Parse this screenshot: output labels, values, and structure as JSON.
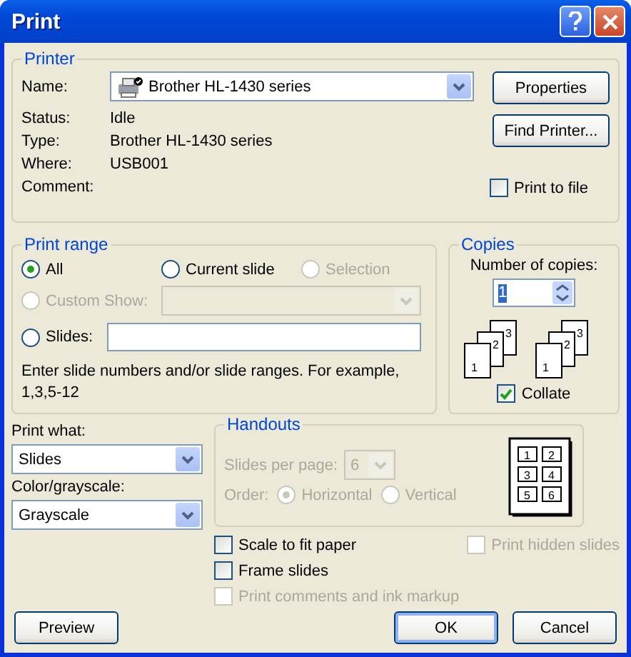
{
  "window": {
    "title": "Print"
  },
  "printer": {
    "label": "Printer",
    "name_label": "Name:",
    "name": "Brother HL-1430 series",
    "status_label": "Status:",
    "status": "Idle",
    "type_label": "Type:",
    "type": "Brother HL-1430 series",
    "where_label": "Where:",
    "where": "USB001",
    "comment_label": "Comment:",
    "buttons": [
      "Properties",
      "Find Printer..."
    ],
    "print_to_file": {
      "label": "Print to file",
      "checked": false
    }
  },
  "print_range": {
    "label": "Print range",
    "options": [
      {
        "label": "All",
        "selected": true,
        "disabled": false
      },
      {
        "label": "Current slide",
        "selected": false,
        "disabled": false
      },
      {
        "label": "Selection",
        "selected": false,
        "disabled": true
      },
      {
        "label": "Custom Show:",
        "selected": false,
        "disabled": true
      },
      {
        "label": "Slides:",
        "selected": false,
        "disabled": false
      }
    ],
    "hint": "Enter slide numbers and/or slide ranges. For example, 1,3,5-12"
  },
  "copies": {
    "label": "Copies",
    "count_label": "Number of copies:",
    "count": "1",
    "collate": {
      "label": "Collate",
      "checked": true
    },
    "page_numbers": [
      [
        "1",
        "2",
        "3"
      ],
      [
        "1",
        "2",
        "3"
      ]
    ]
  },
  "print_what": {
    "label": "Print what:",
    "value": "Slides"
  },
  "color": {
    "label": "Color/grayscale:",
    "value": "Grayscale"
  },
  "handouts": {
    "label": "Handouts",
    "disabled": true,
    "slides_per_page_label": "Slides per page:",
    "slides_per_page": "6",
    "order_label": "Order:",
    "order": [
      {
        "label": "Horizontal",
        "selected": true
      },
      {
        "label": "Vertical",
        "selected": false
      }
    ],
    "preview_numbers": [
      "1",
      "2",
      "3",
      "4",
      "5",
      "6"
    ]
  },
  "options": [
    {
      "label": "Scale to fit paper",
      "checked": false,
      "disabled": false
    },
    {
      "label": "Frame slides",
      "checked": false,
      "disabled": false
    },
    {
      "label": "Print comments and ink markup",
      "checked": false,
      "disabled": true
    },
    {
      "label": "Print hidden slides",
      "checked": false,
      "disabled": true
    }
  ],
  "buttons": [
    {
      "label": "Preview",
      "default": false
    },
    {
      "label": "OK",
      "default": true
    },
    {
      "label": "Cancel",
      "default": false
    }
  ]
}
